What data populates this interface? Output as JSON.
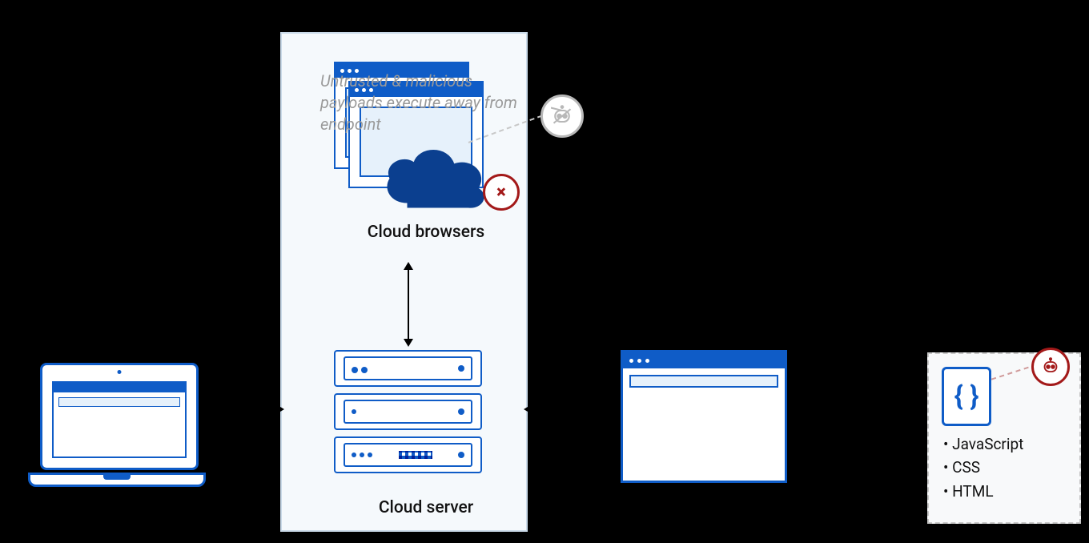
{
  "diagram": {
    "threat_caption": "Untrusted & malicious payloads execute away from endpoint",
    "cloud_browsers_label": "Cloud browsers",
    "cloud_server_label": "Cloud server",
    "code_box": {
      "items": [
        "JavaScript",
        "CSS",
        "HTML"
      ]
    },
    "icons": {
      "block": "×",
      "code": "{ }"
    },
    "colors": {
      "brand": "#0f5cc7",
      "panel": "#f5f9fc",
      "panel_border": "#c9d9e8",
      "danger": "#a31919",
      "muted": "#9a9a9a"
    }
  }
}
